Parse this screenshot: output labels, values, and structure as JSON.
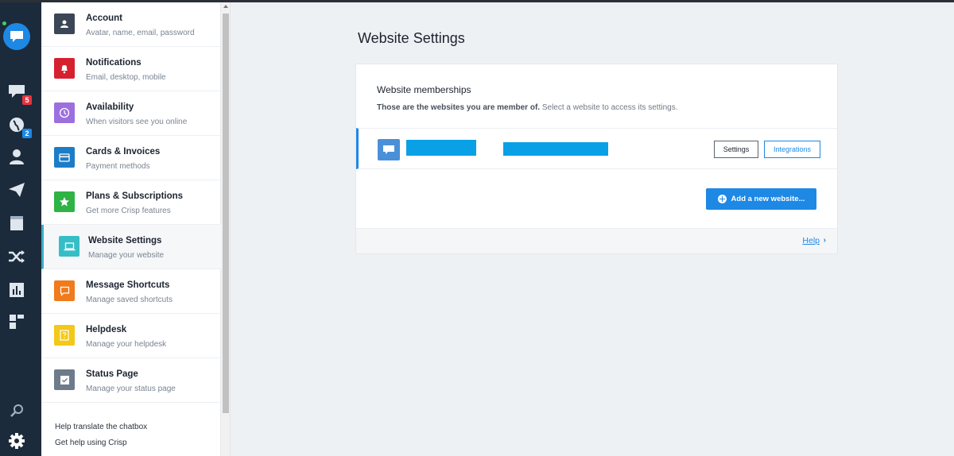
{
  "colors": {
    "accent": "#1e88e5",
    "rail": "#1c2b3c",
    "active_marker": "#3ab0c8"
  },
  "rail": {
    "badges": {
      "messages": "5",
      "visitors": "2"
    }
  },
  "menu": {
    "items": [
      {
        "title": "Account",
        "subtitle": "Avatar, name, email, password",
        "icon": "user-icon",
        "color": "#3b4656"
      },
      {
        "title": "Notifications",
        "subtitle": "Email, desktop, mobile",
        "icon": "bell-icon",
        "color": "#d6202f"
      },
      {
        "title": "Availability",
        "subtitle": "When visitors see you online",
        "icon": "clock-icon",
        "color": "#9c6fe0"
      },
      {
        "title": "Cards & Invoices",
        "subtitle": "Payment methods",
        "icon": "card-icon",
        "color": "#1c7cc6"
      },
      {
        "title": "Plans & Subscriptions",
        "subtitle": "Get more Crisp features",
        "icon": "star-icon",
        "color": "#2fb344"
      },
      {
        "title": "Website Settings",
        "subtitle": "Manage your website",
        "icon": "laptop-icon",
        "color": "#36bec6"
      },
      {
        "title": "Message Shortcuts",
        "subtitle": "Manage saved shortcuts",
        "icon": "message-icon",
        "color": "#f07b1c"
      },
      {
        "title": "Helpdesk",
        "subtitle": "Manage your helpdesk",
        "icon": "help-book-icon",
        "color": "#f2c81a"
      },
      {
        "title": "Status Page",
        "subtitle": "Manage your status page",
        "icon": "checkbox-icon",
        "color": "#6e7b8b"
      }
    ],
    "links": {
      "translate": "Help translate the chatbox",
      "help": "Get help using Crisp"
    }
  },
  "main": {
    "title": "Website Settings",
    "memberships": {
      "title": "Website memberships",
      "desc_bold": "Those are the websites you are member of.",
      "desc_rest": " Select a website to access its settings.",
      "settings_label": "Settings",
      "integrations_label": "Integrations",
      "add_label": "Add a new website...",
      "help_label": "Help"
    }
  }
}
